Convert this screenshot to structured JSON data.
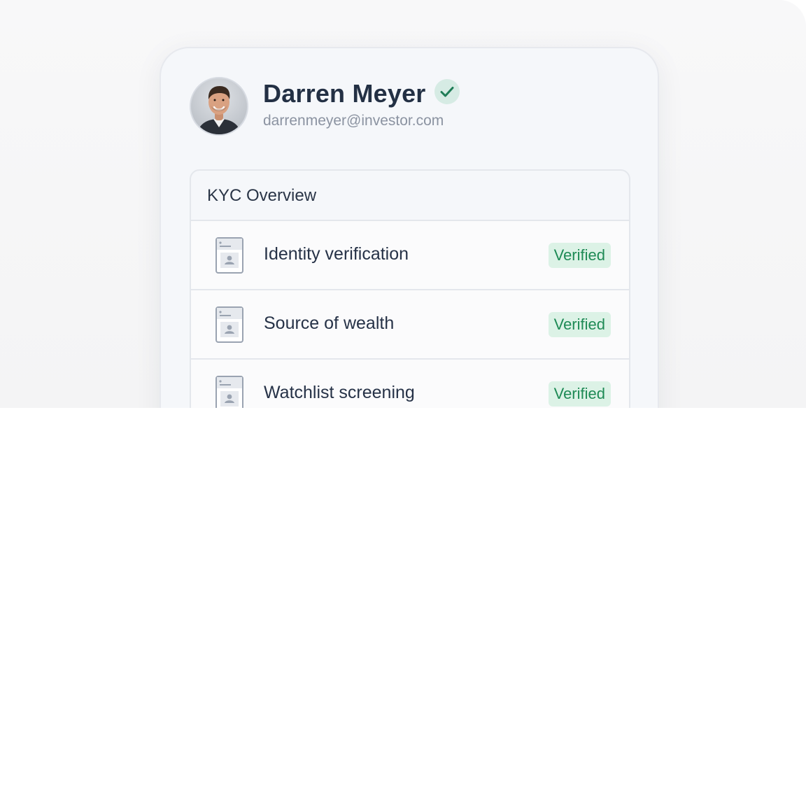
{
  "profile": {
    "name": "Darren Meyer",
    "email": "darrenmeyer@investor.com",
    "verified_icon": "check-circle-icon",
    "avatar": "person-photo"
  },
  "kyc": {
    "title": "KYC Overview",
    "items": [
      {
        "label": "Identity verification",
        "status": "Verified",
        "icon": "id-card-icon"
      },
      {
        "label": "Source of wealth",
        "status": "Verified",
        "icon": "id-card-icon"
      },
      {
        "label": "Watchlist screening",
        "status": "Verified",
        "icon": "id-card-icon"
      }
    ]
  },
  "colors": {
    "name_text": "#233044",
    "email_text": "#8b93a1",
    "verified_green": "#1e8a55",
    "verified_bg": "#dcf2e6",
    "badge_bg": "#d6ebe4",
    "card_bg": "#f5f7fa"
  }
}
